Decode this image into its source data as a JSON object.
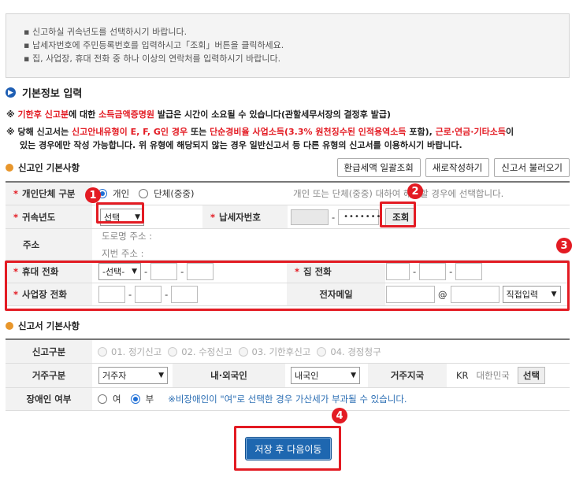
{
  "notice": [
    "신고하실 귀속년도를 선택하시기 바랍니다.",
    "납세자번호에 주민등록번호를 입력하시고「조회」버튼을 클릭하세요.",
    "집, 사업장, 휴대 전화 중 하나 이상의 연락처를 입력하시기 바랍니다."
  ],
  "section_title": "기본정보 입력",
  "warnings": {
    "w1_mark": "※",
    "w1_red": "기한후 신고분",
    "w1_mid": "에 대한",
    "w1_red2": "소득금액증명원",
    "w1_end": "발급은 시간이 소요될 수 있습니다(관할세무서장의 결정후 발급)",
    "w2_mark": "※",
    "w2_a": "당해 신고서는",
    "w2_red1": "신고안내유형이 E, F, G인 경우",
    "w2_b": "또는",
    "w2_red2": "단순경비율 사업소득(3.3% 원천징수된 인적용역소득",
    "w2_c": "포함),",
    "w2_red3": "근로·연금·기타소득",
    "w2_d": "이",
    "w3": "있는 경우에만 작성 가능합니다. 위 유형에 해당되지 않는 경우 일반신고서 등 다른 유형의 신고서를 이용하시기 바랍니다."
  },
  "reporter_section": "신고인 기본사항",
  "top_buttons": {
    "refund": "환급세액 일괄조회",
    "new": "새로작성하기",
    "load": "신고서 불러오기"
  },
  "star": "*",
  "reporter": {
    "type_label": "개인단체 구분",
    "type_opt1": "개인",
    "type_opt2": "단체(중중)",
    "type_hint": "개인 또는 단체(중중) 대하여 해당할 경우에 선택합니다.",
    "year_label": "귀속년도",
    "year_value": "선택",
    "taxno_label": "납세자번호",
    "taxno_dash": "-",
    "taxno_mask": "•••••••",
    "lookup_btn": "조회",
    "addr_label": "주소",
    "addr_road": "도로명 주소 :",
    "addr_lot": "지번 주소 :",
    "mobile_label": "휴대 전화",
    "mobile_select": "-선택-",
    "home_label": "집 전화",
    "biz_label": "사업장 전화",
    "email_label": "전자메일",
    "email_at": "@",
    "email_domain": "직접입력",
    "dash": "-"
  },
  "report_section": "신고서 기본사항",
  "report": {
    "kind_label": "신고구분",
    "kinds": [
      "01. 정기신고",
      "02. 수정신고",
      "03. 기한후신고",
      "04. 경정청구"
    ],
    "residence_label": "거주구분",
    "residence_value": "거주자",
    "nation_label": "내·외국인",
    "nation_value": "내국인",
    "region_label": "거주지국",
    "region_code": "KR",
    "region_name": "대한민국",
    "region_btn": "선택",
    "disabled_label": "장애인 여부",
    "dis_yes": "여",
    "dis_no": "부",
    "dis_note": "※비장애인이 \"여\"로 선택한 경우 가산세가 부과될 수 있습니다."
  },
  "save_button": "저장 후 다음이동",
  "badges": [
    "1",
    "2",
    "3",
    "4"
  ],
  "colors": {
    "highlight": "#e31b23",
    "primary": "#1e67b0"
  }
}
